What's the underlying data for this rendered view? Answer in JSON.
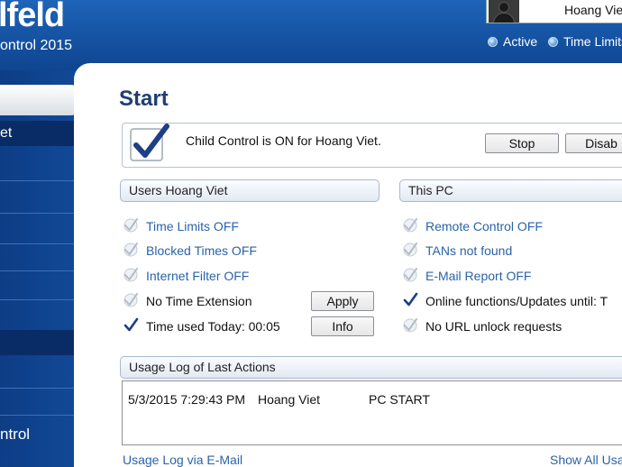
{
  "header": {
    "brand": "lfeld",
    "subtitle": "ontrol 2015",
    "user_name": "Hoang Viet",
    "status": [
      {
        "label": "Active"
      },
      {
        "label": "Time Limits"
      }
    ]
  },
  "sidebar": {
    "active_item": "et",
    "bottom_label": "ntrol"
  },
  "main": {
    "title": "Start",
    "status_text": "Child Control is ON for Hoang Viet.",
    "stop_button": "Stop",
    "disable_button": "Disab",
    "users_header": "Users Hoang Viet",
    "pc_header": "This PC",
    "users_rows": [
      {
        "label": "Time Limits OFF",
        "checked": false,
        "link": true
      },
      {
        "label": "Blocked Times OFF",
        "checked": false,
        "link": true
      },
      {
        "label": "Internet Filter OFF",
        "checked": false,
        "link": true
      },
      {
        "label": "No Time Extension",
        "checked": false,
        "link": false
      },
      {
        "label": "Time used Today: 00:05",
        "checked": true,
        "link": false
      }
    ],
    "apply_button": "Apply",
    "info_button": "Info",
    "pc_rows": [
      {
        "label": "Remote Control OFF",
        "checked": false,
        "link": true
      },
      {
        "label": "TANs not found",
        "checked": false,
        "link": true
      },
      {
        "label": "E-Mail Report OFF",
        "checked": false,
        "link": true
      },
      {
        "label": "Online functions/Updates until: T",
        "checked": true,
        "link": false
      },
      {
        "label": "No URL unlock requests",
        "checked": false,
        "link": false
      }
    ],
    "log_header": "Usage Log of Last Actions",
    "log_entries": [
      {
        "datetime": "5/3/2015 7:29:43 PM",
        "user": "Hoang Viet",
        "action": "PC START"
      }
    ],
    "usage_email_link": "Usage Log via E-Mail",
    "show_all_link": "Show All Usa"
  },
  "colors": {
    "header_blue": "#1552a2",
    "sidebar_blue": "#0d3d85",
    "title_blue": "#1f3e74",
    "link_blue": "#2a63a8",
    "check_blue": "#1c3f86"
  }
}
